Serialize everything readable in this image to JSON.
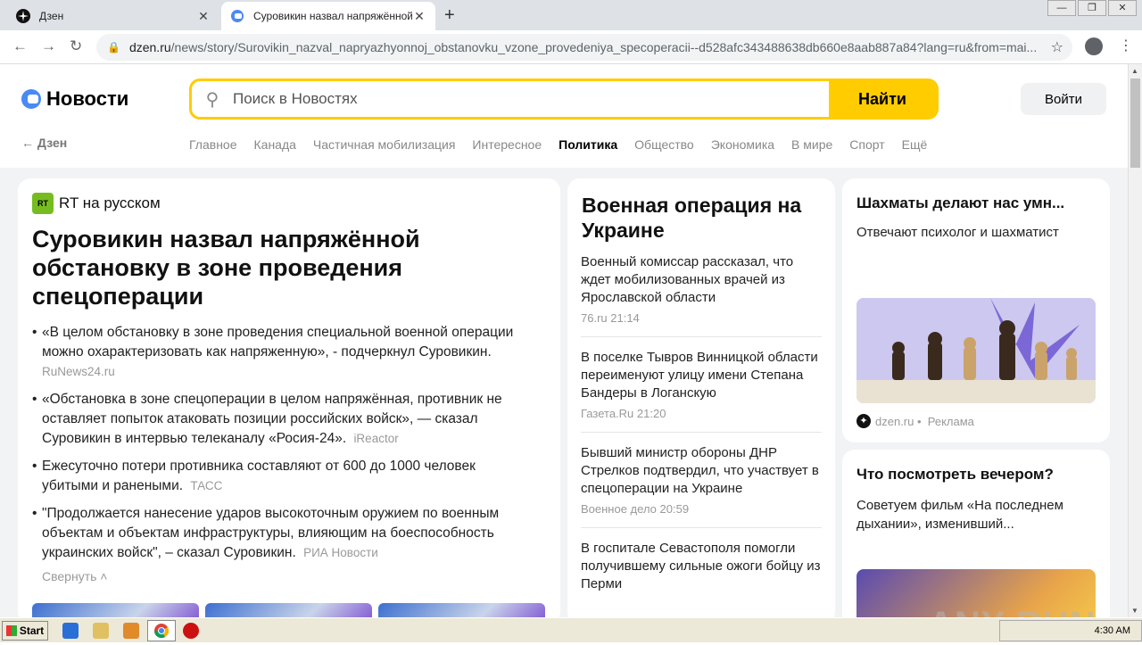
{
  "browser": {
    "tabs": [
      {
        "title": "Дзен"
      },
      {
        "title": "Суровикин назвал напряжённой об..."
      }
    ],
    "window_controls": {
      "minimize": "—",
      "maximize": "❐",
      "close": "✕"
    },
    "url_host": "dzen.ru",
    "url_path": "/news/story/Surovikin_nazval_napryazhyonnoj_obstanovku_vzone_provedeniya_specoperacii--d528afc343488638db660e8aab887a84?lang=ru&from=mai..."
  },
  "header": {
    "logo": "Новости",
    "search_placeholder": "Поиск в Новостях",
    "search_button": "Найти",
    "login": "Войти",
    "back": "Дзен",
    "nav": [
      "Главное",
      "Канада",
      "Частичная мобилизация",
      "Интересное",
      "Политика",
      "Общество",
      "Экономика",
      "В мире",
      "Спорт",
      "Ещё"
    ],
    "nav_current": "Политика"
  },
  "story": {
    "source_badge": "RT",
    "source": "RT на русском",
    "headline": "Суровикин назвал напряжённой обстановку в зоне проведения спецоперации",
    "items": [
      {
        "text": "«В целом обстановку в зоне проведения специальной военной операции можно охарактеризовать как напряженную», - подчеркнул Суровикин.",
        "source": "RuNews24.ru"
      },
      {
        "text": "«Обстановка в зоне спецоперации в целом напряжённая, противник не оставляет попыток атаковать позиции российских войск», — сказал Суровикин в интервью телеканалу «Росия-24».",
        "source": "iReactor"
      },
      {
        "text": "Ежесуточно потери противника составляют от 600 до 1000 человек убитыми и ранеными.",
        "source": "ТАСС"
      },
      {
        "text": "\"Продолжается нанесение ударов высокоточным оружием по военным объектам и объектам инфраструктуры, влияющим на боеспособность украинских войск\", – сказал Суровикин.",
        "source": "РИА Новости"
      }
    ],
    "collapse": "Свернуть"
  },
  "topic": {
    "title": "Военная операция на Украине",
    "news": [
      {
        "title": "Военный комиссар рассказал, что ждет мобилизованных врачей из Ярославской области",
        "meta": "76.ru 21:14"
      },
      {
        "title": "В поселке Тывров Винницкой области переименуют улицу имени Степана Бандеры в Логанскую",
        "meta": "Газета.Ru 21:20"
      },
      {
        "title": "Бывший министр обороны ДНР Стрелков подтвердил, что участвует в спецоперации на Украине",
        "meta": "Военное дело 20:59"
      },
      {
        "title": "В госпитале Севастополя помогли получившему сильные ожоги бойцу из Перми",
        "meta": ""
      }
    ]
  },
  "ad": {
    "title": "Шахматы делают нас умн...",
    "subtitle": "Отвечают психолог и шахматист",
    "site": "dzen.ru",
    "label": "Реклама"
  },
  "evening": {
    "title": "Что посмотреть вечером?",
    "subtitle": "Советуем фильм «На последнем дыхании», изменивший..."
  },
  "watermark": "ANY RUN",
  "taskbar": {
    "start": "Start",
    "time": "4:30 AM"
  }
}
